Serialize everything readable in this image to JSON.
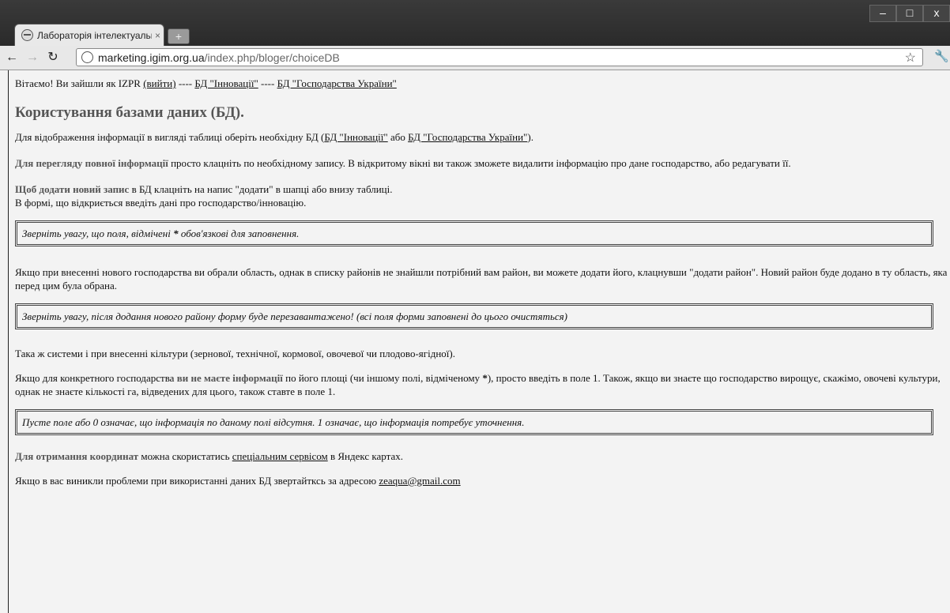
{
  "browser": {
    "tab_title": "Лабораторія інтелектуальн",
    "tab_close": "×",
    "new_tab": "+",
    "url_host": "marketing.igim.org.ua",
    "url_path": "/index.php/bloger/choiceDB",
    "window_controls": {
      "minimize": "–",
      "maximize": "□",
      "close": "x"
    }
  },
  "header": {
    "greeting": "Вітаємо! Ви зайшли як IZPR",
    "logout": "(вийти)",
    "sep1": "----",
    "db1": "БД \"Інновації\"",
    "sep2": "----",
    "db2": "БД \"Господарства України\""
  },
  "title": "Користування базами даних (БД).",
  "para1": {
    "pre": "Для відображення інформації в вигляді таблиці оберіть необхідну БД (",
    "link1": "БД \"Інновації\"",
    "mid": " або ",
    "link2": "БД \"Господарства України\"",
    "post": ")."
  },
  "para2": {
    "bold": "Для перегляду повної інформації",
    "text": " просто клацніть по необхідному запису. В відкритому вікні ви також зможете видалити інформацію про дане господарство, або редагувати її."
  },
  "para3": {
    "bold": "Щоб додати новий запис",
    "text": " в БД клацніть на напис \"додати\" в шапці або внизу таблиці.",
    "line2": "В формі, що відкриється введіть дані про господарство/інновацію."
  },
  "note1": {
    "pre": "Зверніть увагу, що поля, відмічені ",
    "star": "*",
    "post": " обов'язкові для заповнення."
  },
  "para4": "Якщо при внесенні нового господарства ви обрали область, однак в списку районів не знайшли потрібний вам район, ви можете додати його, клацнувши \"додати район\". Новий район буде додано в ту область, яка перед цим була обрана.",
  "note2": "Зверніть увагу, після додання нового району форму буде перезавантажено! (всі поля форми заповнені до цього очистяться)",
  "para5": "Така ж системи і при внесенні кільтури (зернової, технічної, кормової, овочевої чи плодово-ягідної).",
  "para6": {
    "pre": "Якщо для конкретного господарства ",
    "bold": "ви не маєте інформації",
    "mid": " по його площі (чи іншому полі, відміченому ",
    "star": "*",
    "post": "), просто введіть в поле 1. Також, якщо ви знаєте що господарство вирощує, скажімо, овочеві культури, однак не знаєте кількості га, відведених для цього, також ставте в поле 1."
  },
  "note3": "Пусте поле або 0 означає, що інформація по даному полі відсутня. 1 означає, що інформація потребує уточнення.",
  "para7": {
    "bold": "Для отримання координат",
    "mid": " можна скористатись ",
    "link": "спеціальним сервісом",
    "post": " в Яндекс картах."
  },
  "para8": {
    "pre": "Якщо в вас виникли проблеми при використанні даних БД звертайтксь за адресою ",
    "email": "zeaqua@gmail.com"
  }
}
